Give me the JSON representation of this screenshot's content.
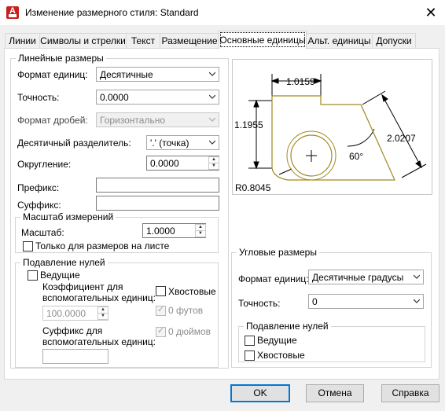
{
  "window": {
    "title": "Изменение размерного стиля: Standard",
    "app_icon_letter": "A"
  },
  "tabs": [
    {
      "label": "Линии"
    },
    {
      "label": "Символы и стрелки"
    },
    {
      "label": "Текст"
    },
    {
      "label": "Размещение"
    },
    {
      "label": "Основные единицы"
    },
    {
      "label": "Альт. единицы"
    },
    {
      "label": "Допуски"
    }
  ],
  "active_tab": "Основные единицы",
  "linear": {
    "title": "Линейные размеры",
    "unit_format_label": "Формат единиц:",
    "unit_format_value": "Десятичные",
    "precision_label": "Точность:",
    "precision_value": "0.0000",
    "fraction_format_label": "Формат дробей:",
    "fraction_format_value": "Горизонтально",
    "decimal_sep_label": "Десятичный  разделитель:",
    "decimal_sep_value": "'.' (точка)",
    "roundoff_label": "Округление:",
    "roundoff_value": "0.0000",
    "prefix_label": "Префикс:",
    "prefix_value": "",
    "suffix_label": "Суффикс:",
    "suffix_value": ""
  },
  "scale": {
    "title": "Масштаб измерений",
    "scale_label": "Масштаб:",
    "scale_value": "1.0000",
    "layout_only_label": "Только для размеров на листе",
    "layout_only_checked": false
  },
  "zero_linear": {
    "title": "Подавление нулей",
    "leading_label": "Ведущие",
    "leading_checked": false,
    "trailing_label": "Хвостовые",
    "trailing_checked": false,
    "sub_factor_label": "Коэффициент для\nвспомогательных единиц:",
    "sub_factor_value": "100.0000",
    "feet_label": "0 футов",
    "feet_checked": true,
    "inches_label": "0 дюймов",
    "inches_checked": true,
    "sub_suffix_label": "Суффикс для\nвспомогательных единиц:",
    "sub_suffix_value": ""
  },
  "preview": {
    "dim_top": "1.0159",
    "dim_left": "1.1955",
    "dim_right": "2.0207",
    "angle": "60°",
    "radius": "R0.8045"
  },
  "angular": {
    "title": "Угловые размеры",
    "unit_format_label": "Формат единиц:",
    "unit_format_value": "Десятичные градусы",
    "precision_label": "Точность:",
    "precision_value": "0",
    "zero_title": "Подавление нулей",
    "leading_label": "Ведущие",
    "leading_checked": false,
    "trailing_label": "Хвостовые",
    "trailing_checked": false
  },
  "buttons": {
    "ok": "OK",
    "cancel": "Отмена",
    "help": "Справка"
  },
  "colors": {
    "accent": "#0078d7",
    "preview_shape": "#a08a1e",
    "app_icon": "#c8201d"
  }
}
